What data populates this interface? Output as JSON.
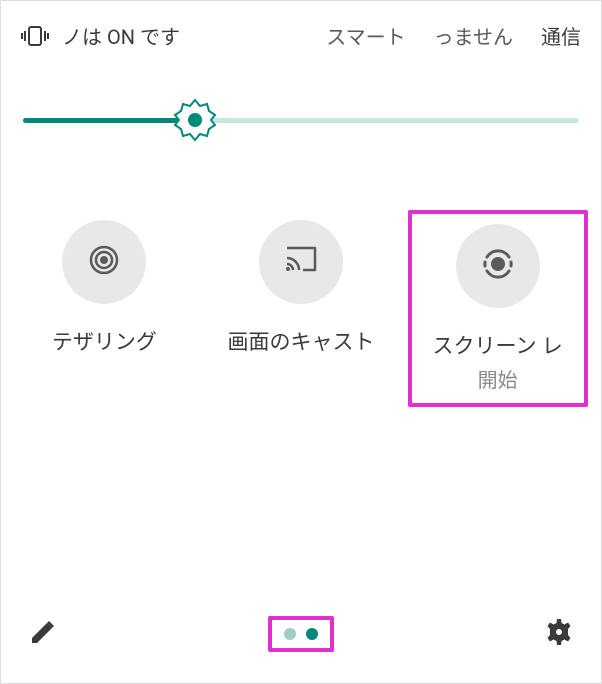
{
  "status": {
    "text1": "ノは ON です",
    "text2": "スマート",
    "text3": "っません",
    "text4": "通信"
  },
  "slider": {
    "percent": 31
  },
  "tiles": [
    {
      "name": "tethering",
      "label": "テザリング",
      "sublabel": ""
    },
    {
      "name": "cast",
      "label": "画面のキャスト",
      "sublabel": ""
    },
    {
      "name": "screen-record",
      "label": "スクリーン レ",
      "sublabel": "開始",
      "highlighted": true
    }
  ],
  "pagination": {
    "current": 2,
    "total": 2
  }
}
